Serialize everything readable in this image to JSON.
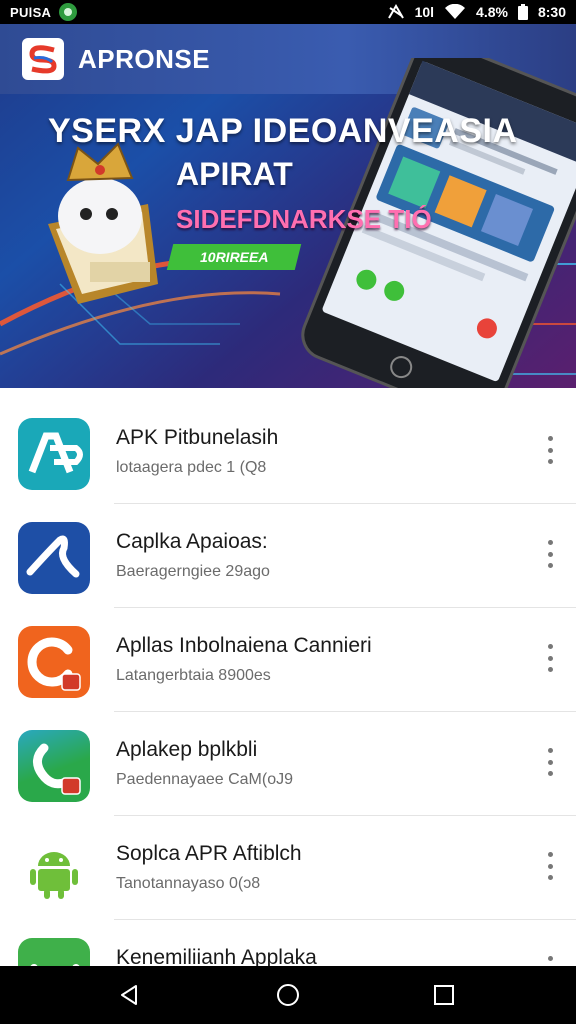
{
  "status_bar": {
    "carrier": "PUlSA",
    "signal_label": "10l",
    "battery": "4.8%",
    "time": "8:30",
    "icons": [
      "nfc-icon",
      "wifi-icon",
      "battery-icon"
    ]
  },
  "banner": {
    "brand": "APRONSE",
    "headline_line1": "YSERX JAP IDEOANVEASIA",
    "headline_line2": "APIRAT",
    "tagline": "SIDEFDNARKSE TIÓ",
    "cta": "10RIREEA",
    "colors": {
      "accent_pink": "#ff6fb0",
      "cta_green": "#3fbf3a"
    }
  },
  "apps": [
    {
      "title": "APK Pitbunelasih",
      "subtitle": "lotaagera pdec 1 (Q8",
      "icon": "ap-icon",
      "color": "#1aa8b8"
    },
    {
      "title": "Caplka Apaioas:",
      "subtitle": "Baeragerngiee 29ago",
      "icon": "blue-logo-icon",
      "color": "#1e4fa6"
    },
    {
      "title": "Apllas Inbolnaiena Cannieri",
      "subtitle": "Latangerbtaia 8900es",
      "icon": "orange-c-icon",
      "color": "#f0641e"
    },
    {
      "title": "Aplakep bplkbli",
      "subtitle": "Paedennayaee CaM(oJ9",
      "icon": "green-phone-icon",
      "color": "#2aa84a"
    },
    {
      "title": "Soplca APR Aftiblch",
      "subtitle": "Tanotannayaso 0(ɔ8",
      "icon": "android-icon",
      "color": "#6fbf3a"
    },
    {
      "title": "Kenemiliianh Applaka",
      "subtitle": "",
      "icon": "green-app-icon",
      "color": "#3fb04a"
    }
  ],
  "nav": {
    "back": "back-icon",
    "home": "home-icon",
    "recents": "recents-icon"
  }
}
